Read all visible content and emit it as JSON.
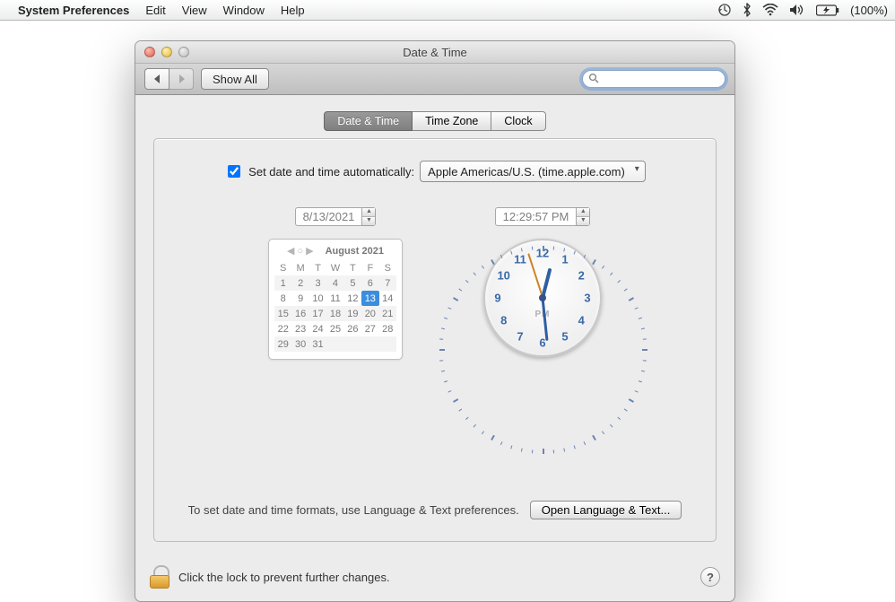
{
  "menubar": {
    "app": "System Preferences",
    "items": [
      "Edit",
      "View",
      "Window",
      "Help"
    ],
    "battery": "(100%)"
  },
  "window": {
    "title": "Date & Time",
    "show_all": "Show All",
    "search_placeholder": ""
  },
  "tabs": [
    "Date & Time",
    "Time Zone",
    "Clock"
  ],
  "active_tab": 0,
  "auto": {
    "label": "Set date and time automatically:",
    "checked": true,
    "server": "Apple Americas/U.S. (time.apple.com)"
  },
  "date_field": "8/13/2021",
  "time_field": "12:29:57 PM",
  "calendar": {
    "month": "August 2021",
    "dow": [
      "S",
      "M",
      "T",
      "W",
      "T",
      "F",
      "S"
    ],
    "weeks": [
      [
        1,
        2,
        3,
        4,
        5,
        6,
        7
      ],
      [
        8,
        9,
        10,
        11,
        12,
        13,
        14
      ],
      [
        15,
        16,
        17,
        18,
        19,
        20,
        21
      ],
      [
        22,
        23,
        24,
        25,
        26,
        27,
        28
      ],
      [
        29,
        30,
        31,
        null,
        null,
        null,
        null
      ]
    ],
    "selected": 13
  },
  "clock": {
    "ampm": "PM",
    "hours": 12,
    "minutes": 29,
    "seconds": 57
  },
  "hint": "To set date and time formats, use Language & Text preferences.",
  "open_btn": "Open Language & Text...",
  "lock_text": "Click the lock to prevent further changes."
}
